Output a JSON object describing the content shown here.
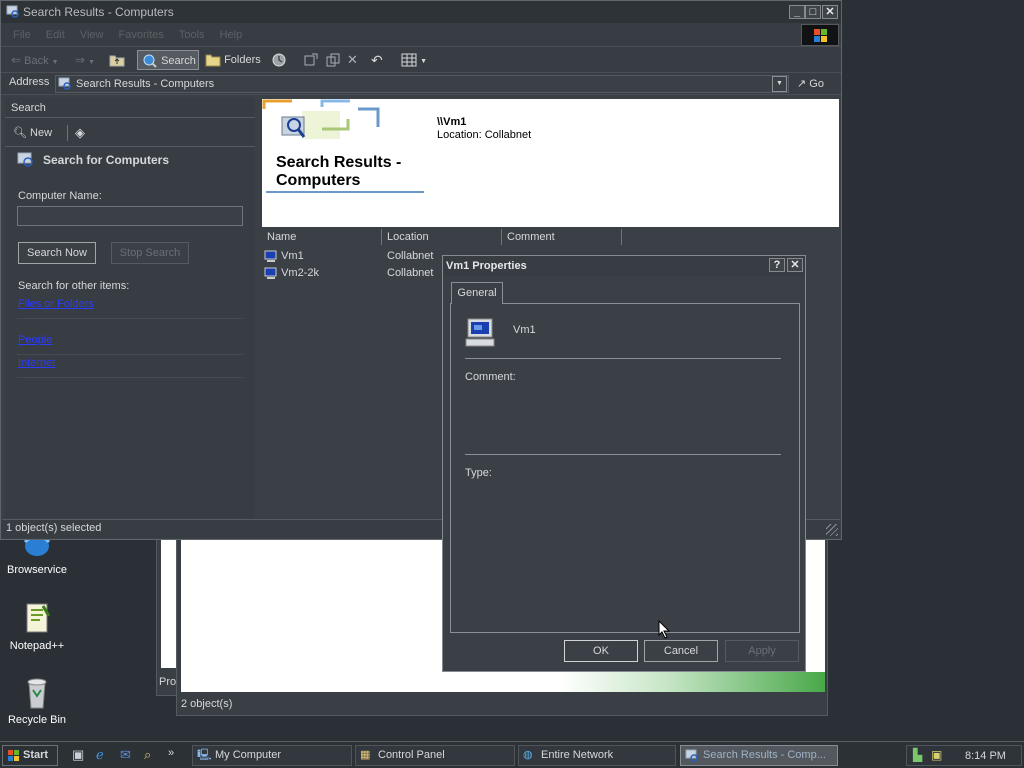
{
  "desktop": {
    "icons": [
      {
        "label": "Browservice"
      },
      {
        "label": "Notepad++"
      },
      {
        "label": "Recycle Bin"
      }
    ]
  },
  "background_window": {
    "partial_text": "Pro",
    "status": "2 object(s)"
  },
  "explorer": {
    "title": "Search Results - Computers",
    "menu": [
      "File",
      "Edit",
      "View",
      "Favorites",
      "Tools",
      "Help"
    ],
    "toolbar": {
      "back": "Back",
      "search": "Search",
      "folders": "Folders"
    },
    "address": {
      "label": "Address",
      "value": "Search Results - Computers",
      "go": "Go"
    },
    "search_pane": {
      "title": "Search",
      "new": "New",
      "heading": "Search for Computers",
      "computer_name_label": "Computer Name:",
      "computer_name_value": "",
      "search_now": "Search Now",
      "stop_search": "Stop Search",
      "other_items_label": "Search for other items:",
      "other_links": [
        "Files or Folders",
        "People",
        "Internet"
      ]
    },
    "banner": {
      "title": "Search Results - Computers",
      "selected_name": "\\\\Vm1",
      "selected_location": "Location: Collabnet"
    },
    "columns": [
      "Name",
      "Location",
      "Comment"
    ],
    "rows": [
      {
        "name": "Vm1",
        "location": "Collabnet"
      },
      {
        "name": "Vm2-2k",
        "location": "Collabnet"
      }
    ],
    "status": "1 object(s) selected"
  },
  "dialog": {
    "title": "Vm1 Properties",
    "help": "?",
    "close": "✕",
    "tab": "General",
    "computer_name": "Vm1",
    "comment_label": "Comment:",
    "type_label": "Type:",
    "ok": "OK",
    "cancel": "Cancel",
    "apply": "Apply"
  },
  "taskbar": {
    "start": "Start",
    "tasks": [
      {
        "label": "My Computer"
      },
      {
        "label": "Control Panel"
      },
      {
        "label": "Entire Network"
      },
      {
        "label": "Search Results - Comp..."
      }
    ],
    "clock": "8:14 PM"
  },
  "colors": {
    "link": "#2b3cff",
    "desktop_bg": "#2b3036",
    "window_bg": "#3b4046"
  }
}
